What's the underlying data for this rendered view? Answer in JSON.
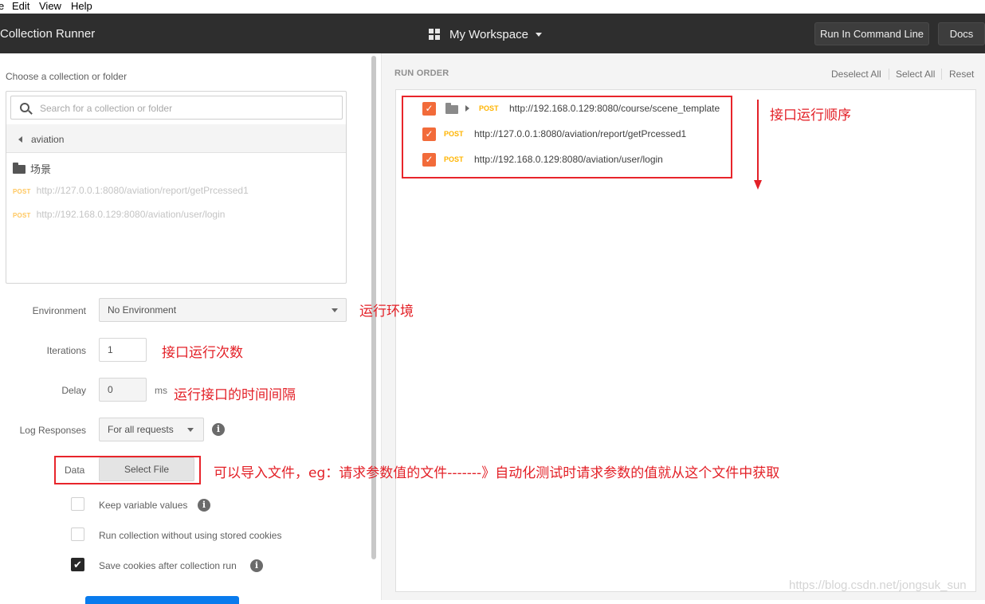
{
  "menu": [
    "e",
    "Edit",
    "View",
    "Help"
  ],
  "titlebar": {
    "app_title": "Collection Runner",
    "workspace": "My Workspace",
    "run_cli_label": "Run In Command Line",
    "docs_label": "Docs"
  },
  "left": {
    "choose_label": "Choose a collection or folder",
    "search_placeholder": "Search for a collection or folder",
    "breadcrumb": "aviation",
    "folder_name": "场景",
    "requests": [
      {
        "method": "POST",
        "url": "http://127.0.0.1:8080/aviation/report/getPrcessed1"
      },
      {
        "method": "POST",
        "url": "http://192.168.0.129:8080/aviation/user/login"
      }
    ],
    "environment_label": "Environment",
    "environment_value": "No Environment",
    "iterations_label": "Iterations",
    "iterations_value": "1",
    "delay_label": "Delay",
    "delay_value": "0",
    "delay_unit": "ms",
    "log_label": "Log Responses",
    "log_value": "For all requests",
    "data_label": "Data",
    "data_button": "Select File",
    "keep_vars_label": "Keep variable values",
    "keep_vars_checked": false,
    "no_cookies_label": "Run collection without using stored cookies",
    "no_cookies_checked": false,
    "save_cookies_label": "Save cookies after collection run",
    "save_cookies_checked": true
  },
  "right": {
    "run_order_label": "RUN ORDER",
    "deselect_all": "Deselect All",
    "select_all": "Select All",
    "reset": "Reset",
    "items": [
      {
        "method": "POST",
        "url": "http://192.168.0.129:8080/course/scene_template",
        "checked": true,
        "in_folder": true
      },
      {
        "method": "POST",
        "url": "http://127.0.0.1:8080/aviation/report/getPrcessed1",
        "checked": true,
        "in_folder": false
      },
      {
        "method": "POST",
        "url": "http://192.168.0.129:8080/aviation/user/login",
        "checked": true,
        "in_folder": false
      }
    ]
  },
  "annotations": {
    "run_order_note": "接口运行顺序",
    "env_note": "运行环境",
    "iterations_note": "接口运行次数",
    "delay_note": "运行接口的时间间隔",
    "data_note": "可以导入文件，eg：请求参数值的文件-------》自动化测试时请求参数的值就从这个文件中获取"
  },
  "watermark": "https://blog.csdn.net/jongsuk_sun",
  "colors": {
    "titlebar_bg": "#2e2e2e",
    "accent_orange": "#f26b3a",
    "method_post": "#ffb400",
    "annotation_red": "#e32027",
    "run_button": "#097bed"
  }
}
